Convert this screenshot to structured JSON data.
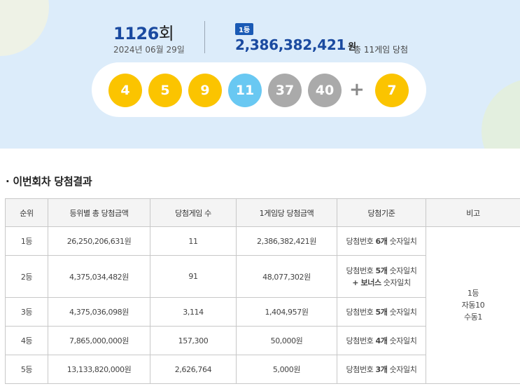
{
  "draw": {
    "number": "1126",
    "unit": "회",
    "date": "2024년 06월 29일",
    "rank_badge": "1등",
    "first_prize": "2,386,382,421",
    "first_prize_unit": "원",
    "winner_note": "총 11게임 당첨"
  },
  "balls": [
    {
      "label": "4",
      "color": "#fbc400"
    },
    {
      "label": "5",
      "color": "#fbc400"
    },
    {
      "label": "9",
      "color": "#fbc400"
    },
    {
      "label": "11",
      "color": "#69c8f2"
    },
    {
      "label": "37",
      "color": "#aaaaaa"
    },
    {
      "label": "40",
      "color": "#aaaaaa"
    }
  ],
  "plus_sign": "+",
  "bonus_ball": {
    "label": "7",
    "color": "#fbc400"
  },
  "section": {
    "bullet": "·",
    "title": "이번회차 당첨결과"
  },
  "table": {
    "headers": [
      "순위",
      "등위별 총 당첨금액",
      "당첨게임 수",
      "1게임당 당첨금액",
      "당첨기준",
      "비고"
    ],
    "rows": [
      {
        "rank": "1등",
        "total": "26,250,206,631원",
        "games": "11",
        "per_game": "2,386,382,421원",
        "crit": [
          [
            "당첨번호 ",
            "6개",
            " 숫자일치"
          ]
        ]
      },
      {
        "rank": "2등",
        "total": "4,375,034,482원",
        "games": "91",
        "per_game": "48,077,302원",
        "crit": [
          [
            "당첨번호 ",
            "5개",
            " 숫자일치"
          ],
          [
            "",
            "+ 보너스",
            " 숫자일치"
          ]
        ]
      },
      {
        "rank": "3등",
        "total": "4,375,036,098원",
        "games": "3,114",
        "per_game": "1,404,957원",
        "crit": [
          [
            "당첨번호 ",
            "5개",
            " 숫자일치"
          ]
        ]
      },
      {
        "rank": "4등",
        "total": "7,865,000,000원",
        "games": "157,300",
        "per_game": "50,000원",
        "crit": [
          [
            "당첨번호 ",
            "4개",
            " 숫자일치"
          ]
        ]
      },
      {
        "rank": "5등",
        "total": "13,133,820,000원",
        "games": "2,626,764",
        "per_game": "5,000원",
        "crit": [
          [
            "당첨번호 ",
            "3개",
            " 숫자일치"
          ]
        ]
      }
    ],
    "remarks": [
      "1등",
      "자동10",
      "수동1"
    ]
  }
}
